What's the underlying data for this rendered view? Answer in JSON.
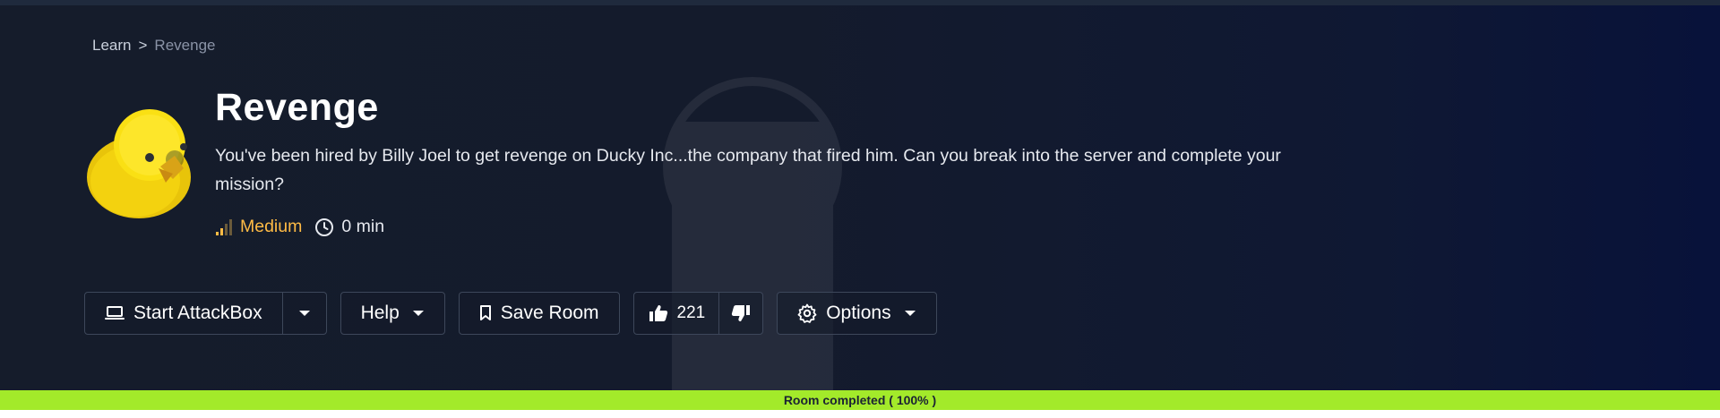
{
  "breadcrumb": {
    "root": "Learn",
    "separator": ">",
    "current": "Revenge"
  },
  "room": {
    "title": "Revenge",
    "description": "You've been hired by Billy Joel to get revenge on Ducky Inc...the company that fired him. Can you break into the server and complete your mission?",
    "difficulty": "Medium",
    "duration": "0 min",
    "icon": "rubber-duck-icon"
  },
  "actions": {
    "start_attackbox": "Start AttackBox",
    "help": "Help",
    "save_room": "Save Room",
    "likes": "221",
    "options": "Options"
  },
  "progress": {
    "label": "Room completed ( 100% )",
    "percent": 100
  },
  "colors": {
    "accent_green": "#a3ea2a",
    "difficulty_color": "#ffbb45",
    "background": "#151c2b"
  }
}
